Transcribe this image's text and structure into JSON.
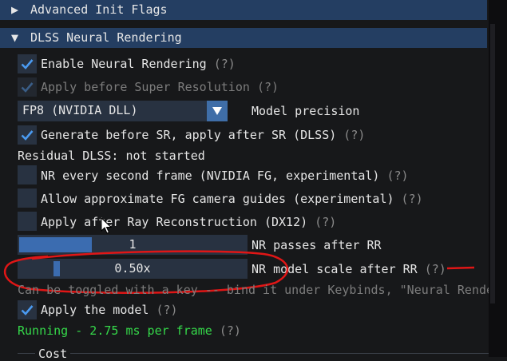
{
  "sections": {
    "advanced_init_flags": {
      "arrow": "▶",
      "label": "Advanced Init Flags"
    },
    "dlss_neural_rendering": {
      "arrow": "▼",
      "label": "DLSS Neural Rendering"
    }
  },
  "options": {
    "enable_neural_rendering": {
      "label": "Enable Neural Rendering",
      "help": "(?)",
      "checked": true
    },
    "apply_before_sr": {
      "label": "Apply before Super Resolution",
      "help": "(?)",
      "checked": true,
      "disabled": true
    },
    "model_precision": {
      "value": "FP8 (NVIDIA DLL)",
      "label": "Model precision"
    },
    "generate_before_sr": {
      "label": "Generate before SR, apply after SR (DLSS)",
      "help": "(?)",
      "checked": true
    },
    "residual_status": "Residual DLSS: not started",
    "nr_every_second_frame": {
      "label": "NR every second frame (NVIDIA FG, experimental)",
      "help": "(?)",
      "checked": false
    },
    "allow_approx_fg": {
      "label": "Allow approximate FG camera guides (experimental)",
      "help": "(?)",
      "checked": false
    },
    "apply_after_rr": {
      "label": "Apply after Ray Reconstruction (DX12)",
      "help": "(?)",
      "checked": false
    },
    "nr_passes": {
      "value": "1",
      "label": "NR passes after RR",
      "fill_fraction": 0.32
    },
    "nr_model_scale": {
      "value": "0.50x",
      "label": "NR model scale after RR",
      "help": "(?)",
      "grab_fraction": 0.15
    },
    "keybind_note": "Can be toggled with a key -- bind it under Keybinds, \"Neural Rende",
    "apply_model": {
      "label": "Apply the model",
      "help": "(?)",
      "checked": true
    },
    "running_status": {
      "text": "Running - 2.75 ms per frame",
      "help": "(?)"
    },
    "cost_section": {
      "label": "Cost"
    }
  },
  "colors": {
    "header_bg": "#243e62",
    "frame_bg": "#283241",
    "check_mark": "#4a9af0",
    "slider_fill": "#3b6cb0",
    "annotation_red": "#e01616",
    "status_green": "#35d94a"
  },
  "icons": {
    "check": "check-icon",
    "combo": "chevron-down-icon",
    "cursor": "mouse-cursor-icon"
  }
}
